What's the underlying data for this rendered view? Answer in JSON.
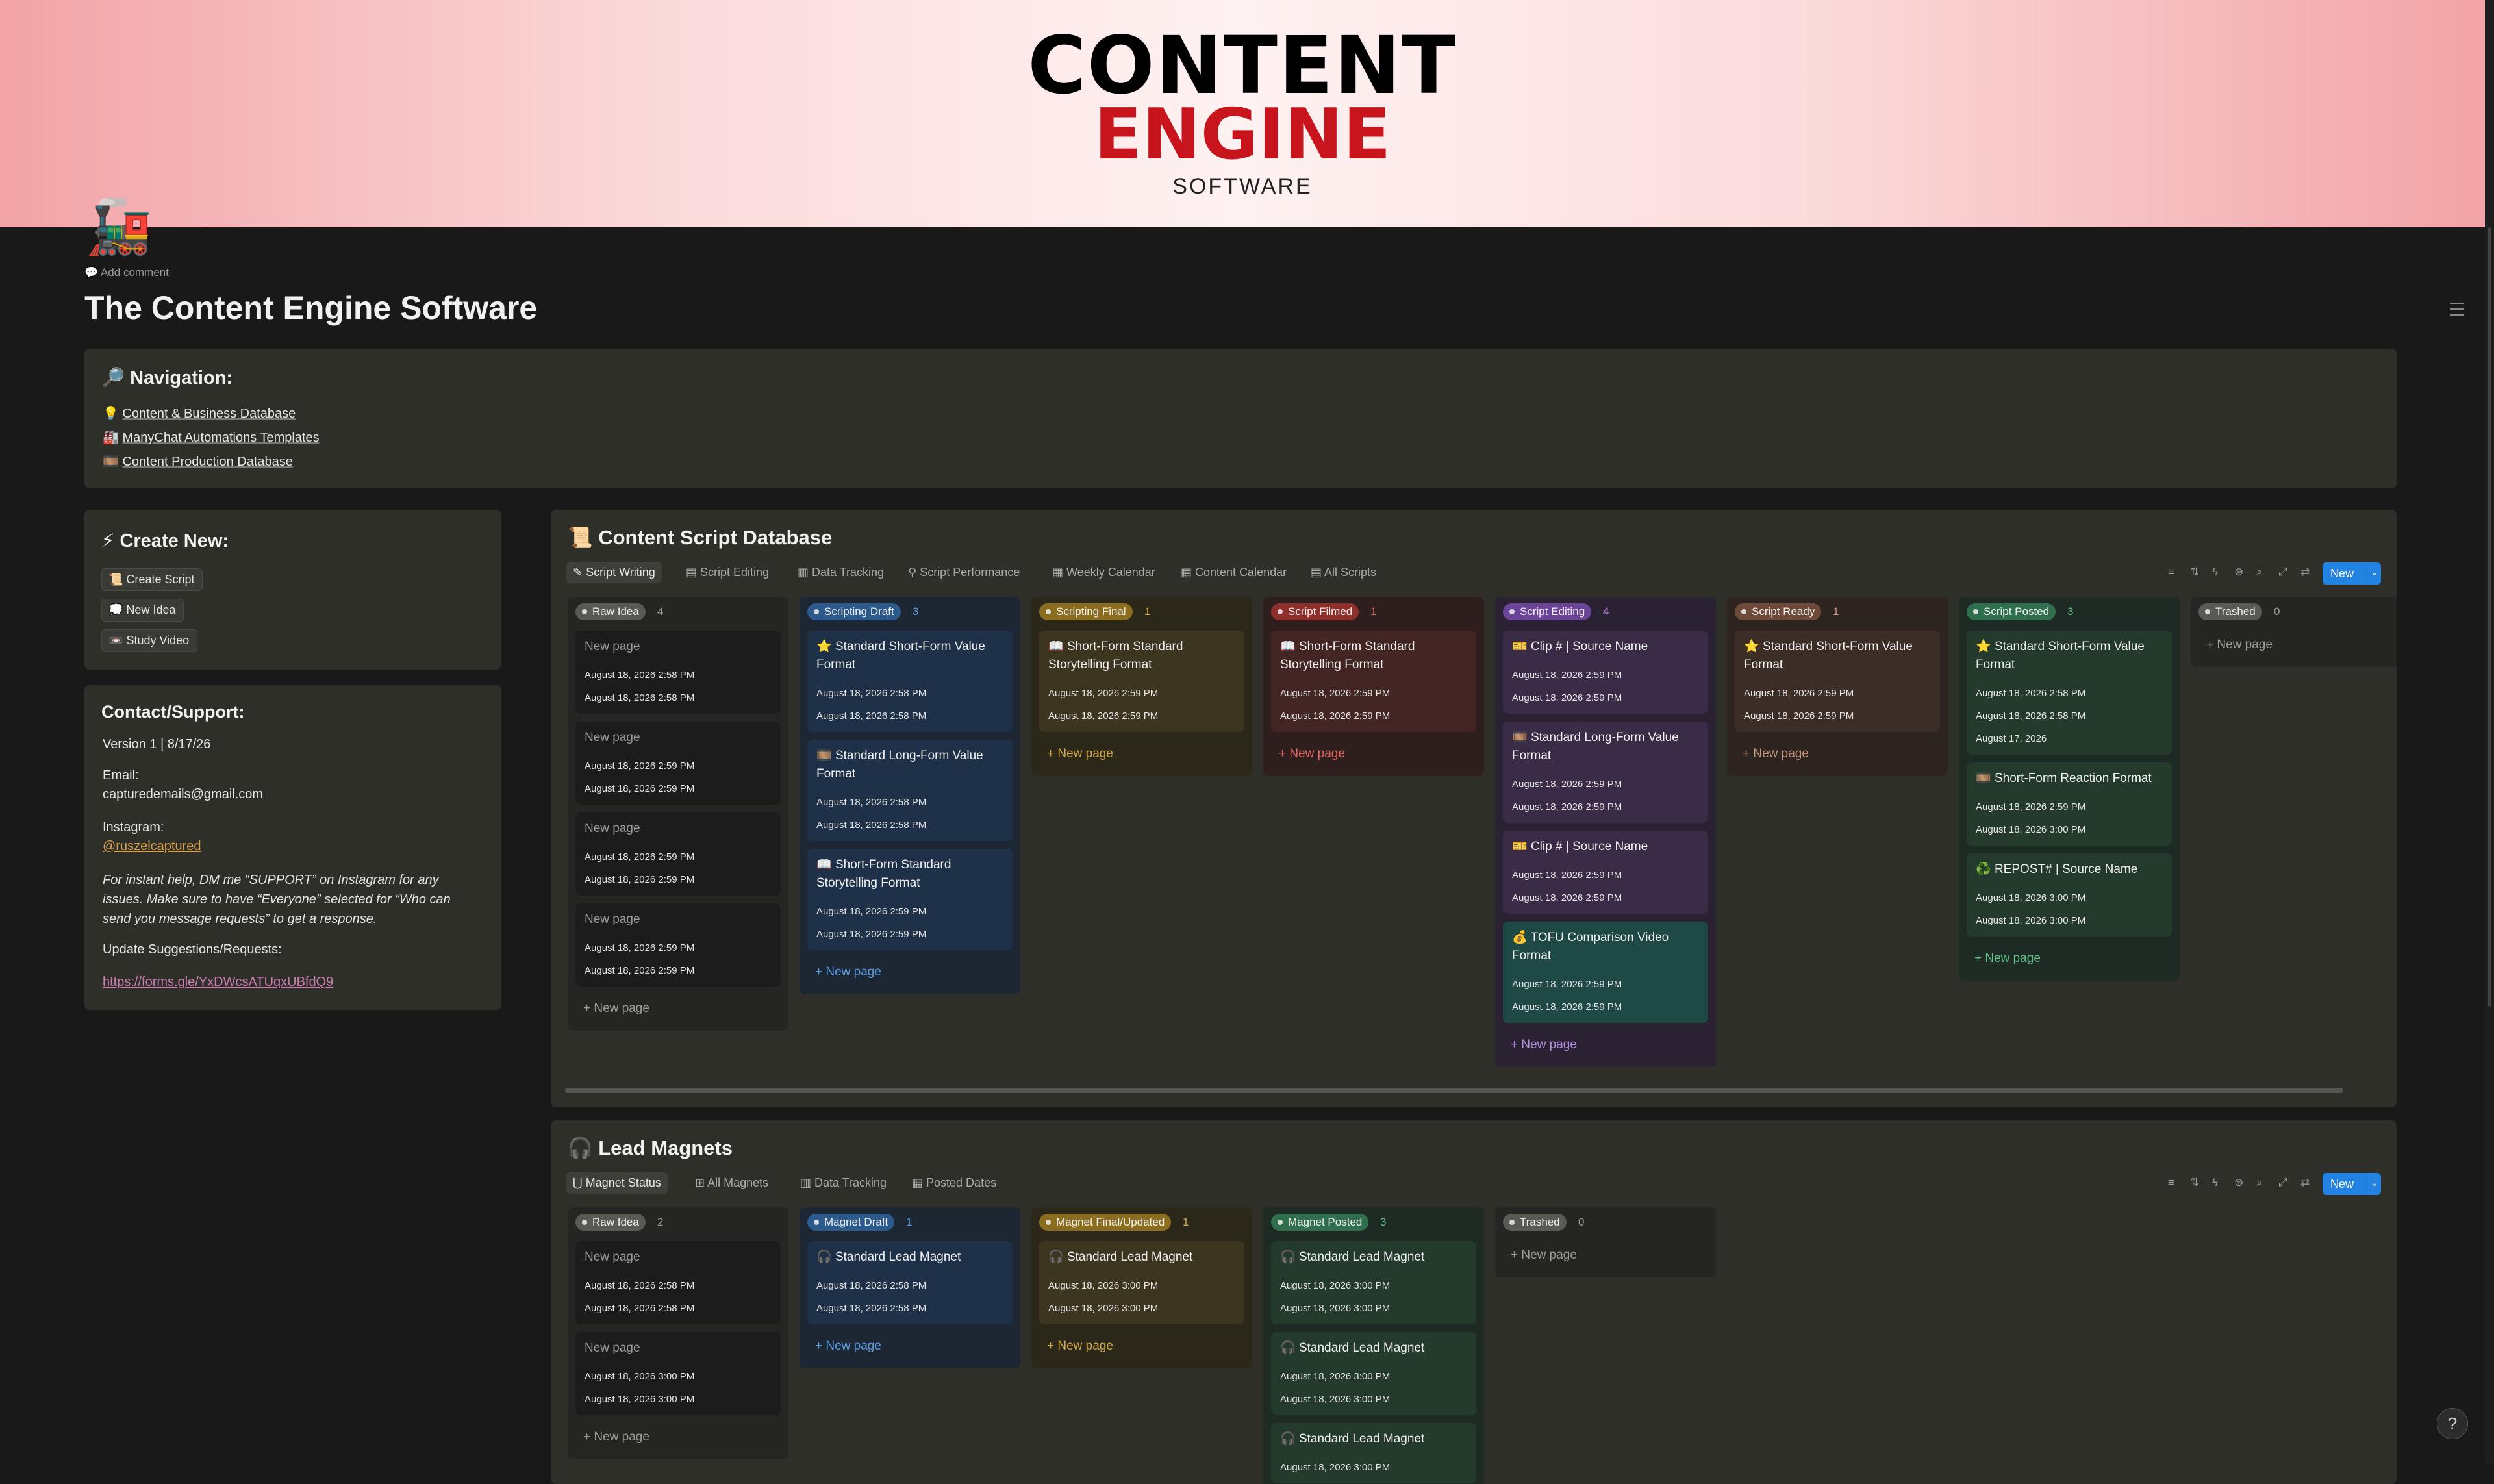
{
  "banner": {
    "title": "CONTENT",
    "title2": "ENGINE",
    "subtitle": "SOFTWARE"
  },
  "page_icon": "locomotive",
  "add_comment": "Add comment",
  "page_title": "The Content Engine Software",
  "navigation": {
    "heading": "Navigation:",
    "links": [
      {
        "icon": "💡",
        "label": "Content & Business Database"
      },
      {
        "icon": "🏭",
        "label": "ManyChat Automations Templates"
      },
      {
        "icon": "🎞️",
        "label": "Content Production Database"
      }
    ]
  },
  "create_new": {
    "heading": "Create New:",
    "buttons": [
      {
        "icon": "📜",
        "label": "Create Script"
      },
      {
        "icon": "💭",
        "label": "New Idea"
      },
      {
        "icon": "📼",
        "label": "Study Video"
      }
    ]
  },
  "contact": {
    "heading": "Contact/Support:",
    "version": "Version 1 | 8/17/26",
    "email_label": "Email:",
    "email": "capturedemails@gmail.com",
    "instagram_label": "Instagram:",
    "instagram": "@ruszelcaptured",
    "help_text": "For instant help, DM me “SUPPORT” on Instagram for any issues. Make sure to have “Everyone” selected for “Who can send you message requests” to get a response.",
    "suggestions_label": "Update Suggestions/Requests:",
    "form_link": "https://forms.gle/YxDWcsATUqxUBfdQ9"
  },
  "script_db": {
    "title": "Content Script Database",
    "tabs": [
      "Script Writing",
      "Script Editing",
      "Data Tracking",
      "Script Performance",
      "Weekly Calendar",
      "Content Calendar",
      "All Scripts"
    ],
    "new_label": "New",
    "new_page": "New page",
    "columns": [
      {
        "name": "Raw Idea",
        "count": "4",
        "cards": [
          {
            "title": "New page",
            "d1": "August 18, 2026 2:58 PM",
            "d2": "August 18, 2026 2:58 PM"
          },
          {
            "title": "New page",
            "d1": "August 18, 2026 2:59 PM",
            "d2": "August 18, 2026 2:59 PM"
          },
          {
            "title": "New page",
            "d1": "August 18, 2026 2:59 PM",
            "d2": "August 18, 2026 2:59 PM"
          },
          {
            "title": "New page",
            "d1": "August 18, 2026 2:59 PM",
            "d2": "August 18, 2026 2:59 PM"
          }
        ]
      },
      {
        "name": "Scripting Draft",
        "count": "3",
        "cards": [
          {
            "icon": "⭐",
            "title": "Standard Short-Form Value Format",
            "d1": "August 18, 2026 2:58 PM",
            "d2": "August 18, 2026 2:58 PM"
          },
          {
            "icon": "🎞️",
            "title": "Standard Long-Form Value Format",
            "d1": "August 18, 2026 2:58 PM",
            "d2": "August 18, 2026 2:58 PM"
          },
          {
            "icon": "📖",
            "title": "Short-Form Standard Storytelling Format",
            "d1": "August 18, 2026 2:59 PM",
            "d2": "August 18, 2026 2:59 PM"
          }
        ]
      },
      {
        "name": "Scripting Final",
        "count": "1",
        "cards": [
          {
            "icon": "📖",
            "title": "Short-Form Standard Storytelling Format",
            "d1": "August 18, 2026 2:59 PM",
            "d2": "August 18, 2026 2:59 PM"
          }
        ]
      },
      {
        "name": "Script Filmed",
        "count": "1",
        "cards": [
          {
            "icon": "📖",
            "title": "Short-Form Standard Storytelling Format",
            "d1": "August 18, 2026 2:59 PM",
            "d2": "August 18, 2026 2:59 PM"
          }
        ]
      },
      {
        "name": "Script Editing",
        "count": "4",
        "cards": [
          {
            "icon": "🎫",
            "title": "Clip # | Source Name",
            "d1": "August 18, 2026 2:59 PM",
            "d2": "August 18, 2026 2:59 PM"
          },
          {
            "icon": "🎞️",
            "title": "Standard Long-Form Value Format",
            "d1": "August 18, 2026 2:59 PM",
            "d2": "August 18, 2026 2:59 PM"
          },
          {
            "icon": "🎫",
            "title": "Clip # | Source Name",
            "d1": "August 18, 2026 2:59 PM",
            "d2": "August 18, 2026 2:59 PM"
          },
          {
            "icon": "💰",
            "title": "TOFU Comparison Video Format",
            "d1": "August 18, 2026 2:59 PM",
            "d2": "August 18, 2026 2:59 PM"
          }
        ]
      },
      {
        "name": "Script Ready",
        "count": "1",
        "cards": [
          {
            "icon": "⭐",
            "title": "Standard Short-Form Value Format",
            "d1": "August 18, 2026 2:59 PM",
            "d2": "August 18, 2026 2:59 PM"
          }
        ]
      },
      {
        "name": "Script Posted",
        "count": "3",
        "cards": [
          {
            "icon": "⭐",
            "title": "Standard Short-Form Value Format",
            "d1": "August 18, 2026 2:58 PM",
            "d2": "August 18, 2026 2:58 PM",
            "d3": "August 17, 2026"
          },
          {
            "icon": "🎞️",
            "title": "Short-Form Reaction Format",
            "d1": "August 18, 2026 2:59 PM",
            "d2": "August 18, 2026 3:00 PM"
          },
          {
            "icon": "♻️",
            "title": "REPOST# | Source Name",
            "d1": "August 18, 2026 3:00 PM",
            "d2": "August 18, 2026 3:00 PM"
          }
        ]
      },
      {
        "name": "Trashed",
        "count": "0",
        "cards": []
      }
    ]
  },
  "lead_db": {
    "title": "Lead Magnets",
    "tabs": [
      "Magnet Status",
      "All Magnets",
      "Data Tracking",
      "Posted Dates"
    ],
    "new_label": "New",
    "new_page": "New page",
    "columns": [
      {
        "name": "Raw Idea",
        "count": "2",
        "cards": [
          {
            "title": "New page",
            "d1": "August 18, 2026 2:58 PM",
            "d2": "August 18, 2026 2:58 PM"
          },
          {
            "title": "New page",
            "d1": "August 18, 2026 3:00 PM",
            "d2": "August 18, 2026 3:00 PM"
          }
        ]
      },
      {
        "name": "Magnet Draft",
        "count": "1",
        "cards": [
          {
            "icon": "🎧",
            "title": "Standard Lead Magnet",
            "d1": "August 18, 2026 2:58 PM",
            "d2": "August 18, 2026 2:58 PM"
          }
        ]
      },
      {
        "name": "Magnet Final/Updated",
        "count": "1",
        "cards": [
          {
            "icon": "🎧",
            "title": "Standard Lead Magnet",
            "d1": "August 18, 2026 3:00 PM",
            "d2": "August 18, 2026 3:00 PM"
          }
        ]
      },
      {
        "name": "Magnet Posted",
        "count": "3",
        "cards": [
          {
            "icon": "🎧",
            "title": "Standard Lead Magnet",
            "d1": "August 18, 2026 3:00 PM",
            "d2": "August 18, 2026 3:00 PM"
          },
          {
            "icon": "🎧",
            "title": "Standard Lead Magnet",
            "d1": "August 18, 2026 3:00 PM",
            "d2": "August 18, 2026 3:00 PM"
          },
          {
            "icon": "🎧",
            "title": "Standard Lead Magnet",
            "d1": "August 18, 2026 3:00 PM",
            "d2": ""
          }
        ]
      },
      {
        "name": "Trashed",
        "count": "0",
        "cards": []
      }
    ]
  },
  "colors": {
    "gray": {
      "col": "#252523",
      "card": "#1c1c1c",
      "tag": "#5a5a55",
      "count": "#9b9b9b",
      "np": "#9b9b9b"
    },
    "blue": {
      "col": "#1d2733",
      "card": "#1e3148",
      "tag": "#2c5a8c",
      "count": "#5a9ae0",
      "np": "#5a9ae0"
    },
    "yellow": {
      "col": "#2c2819",
      "card": "#3c351f",
      "tag": "#8a6d1f",
      "count": "#d3a94a",
      "np": "#d3a94a"
    },
    "red": {
      "col": "#2e1f1e",
      "card": "#432524",
      "tag": "#8f2f2c",
      "count": "#e06a63",
      "np": "#e06a63"
    },
    "purple": {
      "col": "#2a2132",
      "card": "#3a2c47",
      "tag": "#6c4497",
      "count": "#b68de0",
      "np": "#b68de0"
    },
    "brown": {
      "col": "#2d231f",
      "card": "#3d2d27",
      "tag": "#6e4a3a",
      "count": "#c4967d",
      "np": "#c4967d"
    },
    "green": {
      "col": "#1e2b24",
      "card": "#233a2d",
      "tag": "#2f6f4e",
      "count": "#5fc08a",
      "np": "#5fc08a"
    },
    "teal": "#1e4945"
  }
}
